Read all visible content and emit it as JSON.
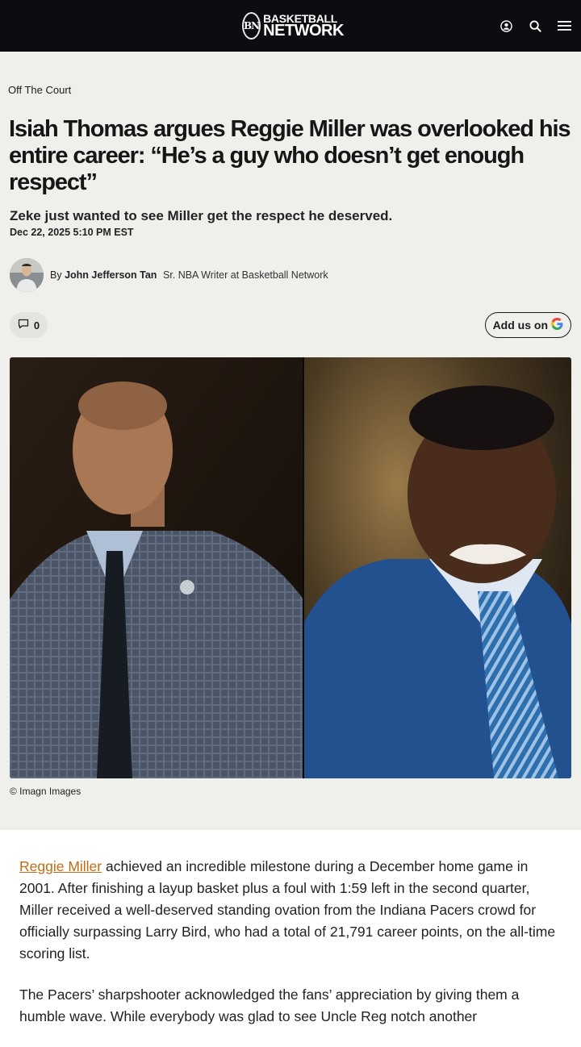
{
  "header": {
    "logo_mark": "BN",
    "logo_line1": "BASKETBALL",
    "logo_line2": "NETWORK",
    "icons": [
      "account-icon",
      "search-icon",
      "menu-icon"
    ]
  },
  "article": {
    "category": "Off The Court",
    "headline": "Isiah Thomas argues Reggie Miller was overlooked his entire career: “He’s a guy who doesn’t get enough respect”",
    "subheadline": "Zeke just wanted to see Miller get the respect he deserved.",
    "date": "Dec 22, 2025 5:10 PM EST",
    "author_prefix": "By",
    "author_name": "John Jefferson Tan",
    "author_role": "Sr. NBA Writer at Basketball Network",
    "comment_count": "0",
    "add_us_label": "Add us on",
    "image_credit": "© Imagn Images",
    "paragraph1_link": "Reggie Miller",
    "paragraph1_rest": " achieved an incredible milestone during a December home game in 2001. After finishing a layup basket plus a foul with 1:59 left in the second quarter, Miller received a well-deserved standing ovation from the Indiana Pacers crowd for officially surpassing Larry Bird, who had a total of 21,791 career points, on the all-time scoring list.",
    "paragraph2": "The Pacers’ sharpshooter acknowledged the fans’ appreciation by giving them a humble wave. While everybody was glad to see Uncle Reg notch another"
  },
  "colors": {
    "topbar": "#0d0d11",
    "header_bg": "#efefeb",
    "link": "#c26a12"
  }
}
